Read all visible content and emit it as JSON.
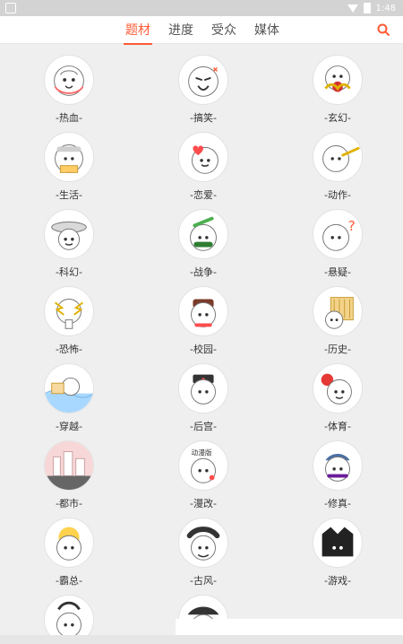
{
  "status": {
    "time": "1:48"
  },
  "tabs": [
    {
      "label": "题材",
      "active": true
    },
    {
      "label": "进度",
      "active": false
    },
    {
      "label": "受众",
      "active": false
    },
    {
      "label": "媒体",
      "active": false
    }
  ],
  "items": [
    {
      "label": "-热血-"
    },
    {
      "label": "-搞笑-"
    },
    {
      "label": "-玄幻-"
    },
    {
      "label": "-生活-"
    },
    {
      "label": "-恋爱-"
    },
    {
      "label": "-动作-"
    },
    {
      "label": "-科幻-"
    },
    {
      "label": "-战争-"
    },
    {
      "label": "-悬疑-"
    },
    {
      "label": "-恐怖-"
    },
    {
      "label": "-校园-"
    },
    {
      "label": "-历史-"
    },
    {
      "label": "-穿越-"
    },
    {
      "label": "-后宫-"
    },
    {
      "label": "-体育-"
    },
    {
      "label": "-都市-"
    },
    {
      "label": "-漫改-"
    },
    {
      "label": "-修真-"
    },
    {
      "label": "-霸总-"
    },
    {
      "label": "-古风-"
    },
    {
      "label": "-游戏-"
    },
    {
      "label": ""
    },
    {
      "label": ""
    }
  ],
  "avatar_text": {
    "man_gai": "动漫版"
  },
  "icons": {
    "search": "search-icon",
    "status_wifi": "wifi-icon",
    "status_battery": "battery-icon"
  },
  "colors": {
    "accent": "#ff5b35",
    "background": "#efefef",
    "topbar": "#ffffff"
  }
}
